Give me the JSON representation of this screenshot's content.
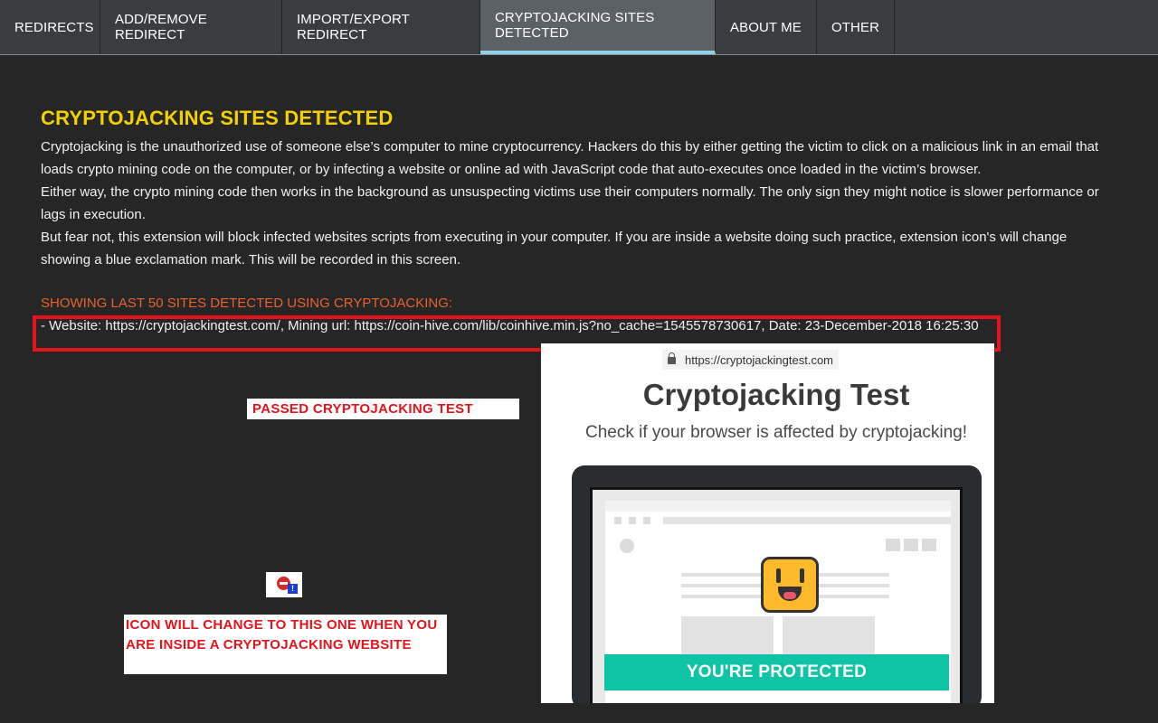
{
  "tabs": [
    {
      "label": "REDIRECTS"
    },
    {
      "label": "ADD/REMOVE REDIRECT"
    },
    {
      "label": "IMPORT/EXPORT REDIRECT"
    },
    {
      "label": "CRYPTOJACKING SITES DETECTED"
    },
    {
      "label": "ABOUT ME"
    },
    {
      "label": "OTHER"
    }
  ],
  "main": {
    "heading": "CRYPTOJACKING SITES DETECTED",
    "paragraphs": [
      "Cryptojacking is the unauthorized use of someone else’s computer to mine cryptocurrency. Hackers do this by either getting the victim to click on a malicious link in an email that loads crypto mining code on the computer, or by infecting a website or online ad with JavaScript code that auto-executes once loaded in the victim’s browser.",
      "Either way, the crypto mining code then works in the background as unsuspecting victims use their computers normally. The only sign they might notice is slower performance or lags in execution.",
      "But fear not, this extension will block infected websites scripts from executing in your computer. If you are inside a website doing such practice, extension icon's will change showing a blue exclamation mark. This will be recorded in this screen."
    ],
    "list_heading": "SHOWING LAST 50 SITES DETECTED USING CRYPTOJACKING:",
    "entries": [
      "- Website: https://cryptojackingtest.com/, Mining url: https://coin-hive.com/lib/coinhive.min.js?no_cache=1545578730617, Date: 23-December-2018 16:25:30"
    ]
  },
  "annotations": {
    "passed": "PASSED CRYPTOJACKING TEST",
    "icon_note": "ICON WILL CHANGE TO THIS ONE WHEN YOU ARE INSIDE A CRYPTOJACKING WEBSITE",
    "badge_char": "!"
  },
  "test_page": {
    "url": "https://cryptojackingtest.com",
    "title": "Cryptojacking Test",
    "subtitle": "Check if your browser is affected by cryptojacking!",
    "result": "YOU'RE PROTECTED"
  },
  "colors": {
    "heading": "#f5d000",
    "list_heading": "#e8622a",
    "highlight_border": "#e3141b",
    "active_tab_underline": "#8fd1e6",
    "protected_bar": "#0fc4a5"
  }
}
